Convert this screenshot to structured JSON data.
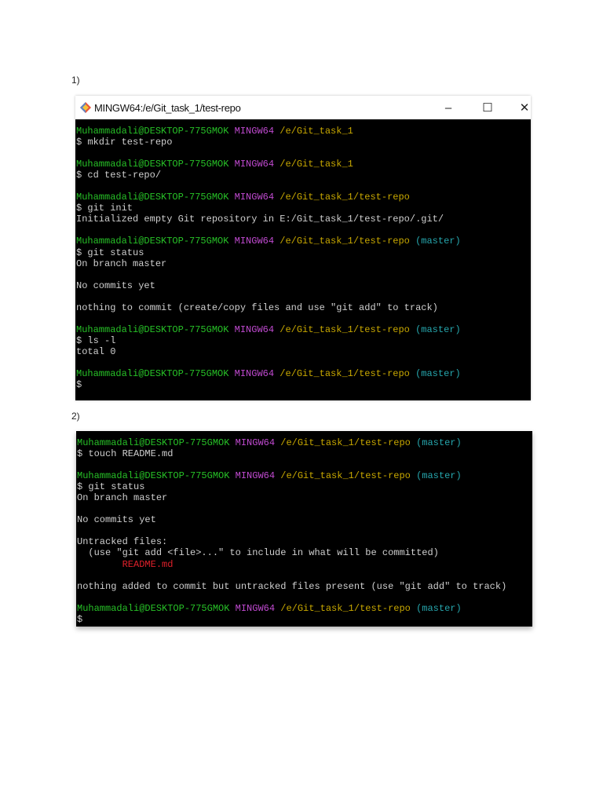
{
  "section1": {
    "label": "1)",
    "window": {
      "title": "MINGW64:/e/Git_task_1/test-repo",
      "minimize": "–",
      "maximize": "☐",
      "close": "✕"
    },
    "lines": [
      [
        [
          "user",
          "Muhammadali@DESKTOP-775GMOK "
        ],
        [
          "host",
          "MINGW64 "
        ],
        [
          "path",
          "/e/Git_task_1"
        ]
      ],
      [
        [
          "text",
          "$ mkdir test-repo"
        ]
      ],
      [],
      [
        [
          "user",
          "Muhammadali@DESKTOP-775GMOK "
        ],
        [
          "host",
          "MINGW64 "
        ],
        [
          "path",
          "/e/Git_task_1"
        ]
      ],
      [
        [
          "text",
          "$ cd test-repo/"
        ]
      ],
      [],
      [
        [
          "user",
          "Muhammadali@DESKTOP-775GMOK "
        ],
        [
          "host",
          "MINGW64 "
        ],
        [
          "path",
          "/e/Git_task_1/test-repo"
        ]
      ],
      [
        [
          "text",
          "$ git init"
        ]
      ],
      [
        [
          "text",
          "Initialized empty Git repository in E:/Git_task_1/test-repo/.git/"
        ]
      ],
      [],
      [
        [
          "user",
          "Muhammadali@DESKTOP-775GMOK "
        ],
        [
          "host",
          "MINGW64 "
        ],
        [
          "path",
          "/e/Git_task_1/test-repo "
        ],
        [
          "branch",
          "(master)"
        ]
      ],
      [
        [
          "text",
          "$ git status"
        ]
      ],
      [
        [
          "text",
          "On branch master"
        ]
      ],
      [],
      [
        [
          "text",
          "No commits yet"
        ]
      ],
      [],
      [
        [
          "text",
          "nothing to commit (create/copy files and use \"git add\" to track)"
        ]
      ],
      [],
      [
        [
          "user",
          "Muhammadali@DESKTOP-775GMOK "
        ],
        [
          "host",
          "MINGW64 "
        ],
        [
          "path",
          "/e/Git_task_1/test-repo "
        ],
        [
          "branch",
          "(master)"
        ]
      ],
      [
        [
          "text",
          "$ ls -l"
        ]
      ],
      [
        [
          "text",
          "total 0"
        ]
      ],
      [],
      [
        [
          "user",
          "Muhammadali@DESKTOP-775GMOK "
        ],
        [
          "host",
          "MINGW64 "
        ],
        [
          "path",
          "/e/Git_task_1/test-repo "
        ],
        [
          "branch",
          "(master)"
        ]
      ],
      [
        [
          "text",
          "$"
        ]
      ]
    ]
  },
  "section2": {
    "label": "2)",
    "lines": [
      [
        [
          "user",
          "Muhammadali@DESKTOP-775GMOK "
        ],
        [
          "host",
          "MINGW64 "
        ],
        [
          "path",
          "/e/Git_task_1/test-repo "
        ],
        [
          "branch",
          "(master)"
        ]
      ],
      [
        [
          "text",
          "$ touch README.md"
        ]
      ],
      [],
      [
        [
          "user",
          "Muhammadali@DESKTOP-775GMOK "
        ],
        [
          "host",
          "MINGW64 "
        ],
        [
          "path",
          "/e/Git_task_1/test-repo "
        ],
        [
          "branch",
          "(master)"
        ]
      ],
      [
        [
          "text",
          "$ git status"
        ]
      ],
      [
        [
          "text",
          "On branch master"
        ]
      ],
      [],
      [
        [
          "text",
          "No commits yet"
        ]
      ],
      [],
      [
        [
          "text",
          "Untracked files:"
        ]
      ],
      [
        [
          "text",
          "  (use \"git add <file>...\" to include in what will be committed)"
        ]
      ],
      [
        [
          "text",
          "        "
        ],
        [
          "red",
          "README.md"
        ]
      ],
      [],
      [
        [
          "text",
          "nothing added to commit but untracked files present (use \"git add\" to track)"
        ]
      ],
      [],
      [
        [
          "user",
          "Muhammadali@DESKTOP-775GMOK "
        ],
        [
          "host",
          "MINGW64 "
        ],
        [
          "path",
          "/e/Git_task_1/test-repo "
        ],
        [
          "branch",
          "(master)"
        ]
      ],
      [
        [
          "text",
          "$"
        ]
      ]
    ]
  },
  "colors": {
    "user": "#27c127",
    "host": "#c04ad0",
    "path": "#c8a800",
    "branch": "#26a6ad",
    "red": "#e0202a",
    "text": "#cfcfcf"
  }
}
